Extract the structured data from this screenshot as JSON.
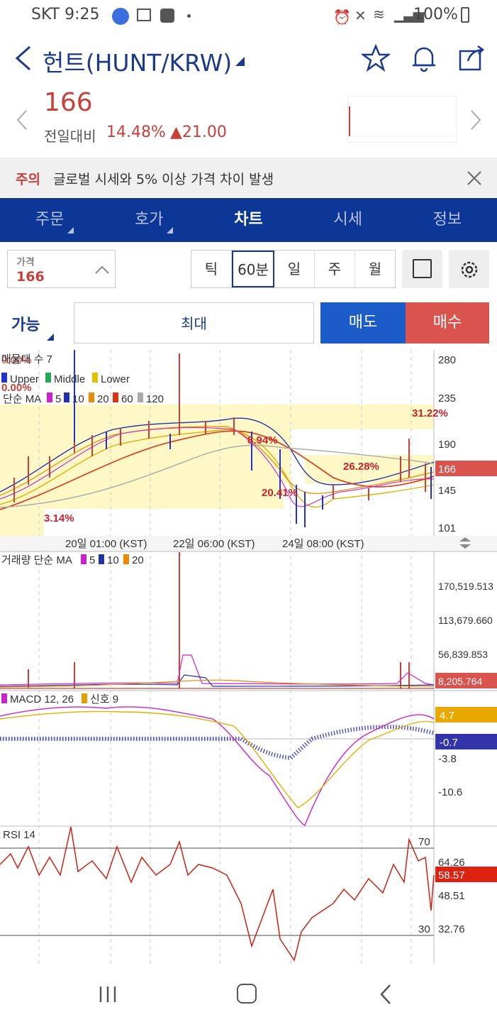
{
  "status_bar": {
    "carrier_time": "SKT 9:25",
    "battery": "100%"
  },
  "header": {
    "title": "헌트(HUNT/KRW)"
  },
  "quote": {
    "price": "166",
    "change_label": "전일대비",
    "change_pct": "14.48%",
    "change_abs": "▲21.00"
  },
  "warning": {
    "label": "주의",
    "message": "글로벌 시세와 5% 이상 가격 차이 발생"
  },
  "tabs": [
    {
      "label": "주문"
    },
    {
      "label": "호가"
    },
    {
      "label": "차트"
    },
    {
      "label": "시세"
    },
    {
      "label": "정보"
    }
  ],
  "price_input": {
    "label": "가격",
    "value": "166"
  },
  "periods": [
    {
      "label": "틱"
    },
    {
      "label": "60분"
    },
    {
      "label": "일"
    },
    {
      "label": "주"
    },
    {
      "label": "월"
    }
  ],
  "order": {
    "available": "가능",
    "max": "최대",
    "sell": "매도",
    "buy": "매수"
  },
  "chart": {
    "legend_bb": "매물대 수 7",
    "legend_bb_pct": "0.00%",
    "legend_bands": [
      "Upper",
      "Middle",
      "Lower"
    ],
    "legend_ma": [
      "단순 MA",
      "5",
      "10",
      "20",
      "60",
      "120"
    ],
    "price_axis": [
      "280",
      "235",
      "190",
      "145",
      "101"
    ],
    "current_price_tag": "166",
    "annotations": [
      "31.22%",
      "8.94%",
      "26.28%",
      "20.41%",
      "3.14%"
    ],
    "time_axis": [
      "20일 01:00 (KST)",
      "22일 06:00 (KST)",
      "24일 08:00 (KST)"
    ],
    "volume_legend": [
      "거래량 단순 MA",
      "5",
      "10",
      "20"
    ],
    "volume_axis": [
      "170,519.513",
      "113,679.660",
      "56,839.853"
    ],
    "volume_tag": "8,205.764",
    "macd_legend": [
      "MACD 12, 26",
      "신호 9"
    ],
    "macd_axis": [
      "-3.8",
      "-10.6"
    ],
    "macd_tags": [
      "4.7",
      "-0.7"
    ],
    "rsi_legend": "RSI 14",
    "rsi_levels": [
      "70",
      "30"
    ],
    "rsi_axis": [
      "64.26",
      "48.51",
      "32.76"
    ],
    "rsi_tag": "58.57"
  },
  "colors": {
    "brand": "#0c3796",
    "up": "#c8403a",
    "sell": "#1b5cc8",
    "buy": "#d9534f"
  }
}
